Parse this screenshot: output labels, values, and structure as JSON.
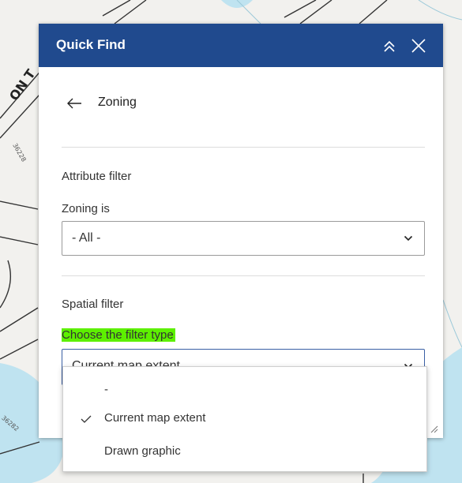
{
  "map": {
    "street_label": "ON T",
    "parcel_labels": [
      "36228",
      "36282"
    ]
  },
  "panel": {
    "title": "Quick Find",
    "collapse_icon": "double-chevron-up-icon",
    "close_icon": "close-icon",
    "back_icon": "arrow-left-icon",
    "layer_name": "Zoning",
    "attribute_filter": {
      "section_label": "Attribute filter",
      "field_label": "Zoning is",
      "value": "- All -"
    },
    "spatial_filter": {
      "section_label": "Spatial filter",
      "field_label": "Choose the filter type",
      "value": "Current map extent",
      "options": [
        {
          "label": "-",
          "selected": false
        },
        {
          "label": "Current map extent",
          "selected": true
        },
        {
          "label": "Drawn graphic",
          "selected": false
        }
      ]
    }
  },
  "colors": {
    "header_bg": "#204a8e",
    "highlight": "#5df000",
    "water": "#bfe3f0"
  }
}
